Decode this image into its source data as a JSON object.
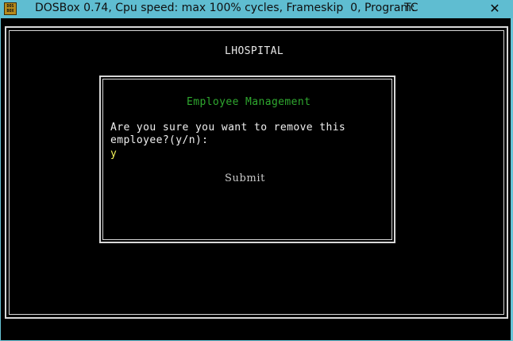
{
  "window": {
    "title": "DOSBox 0.74, Cpu speed: max 100% cycles, Frameskip  0, Program:",
    "program": "TC",
    "icon_text": "DOS BOX",
    "close_glyph": "✕",
    "titlebar_color": "#5fbdd1",
    "screen_background": "#000000"
  },
  "app": {
    "title": "LHOSPITAL"
  },
  "dialog": {
    "heading": "Employee Management",
    "heading_color": "#2fa82f",
    "prompt_line1": "Are you sure you want to remove this",
    "prompt_line2": "employee?(y/n):",
    "input_value": "y",
    "input_color": "#f2f25a",
    "submit_label": "Submit"
  }
}
